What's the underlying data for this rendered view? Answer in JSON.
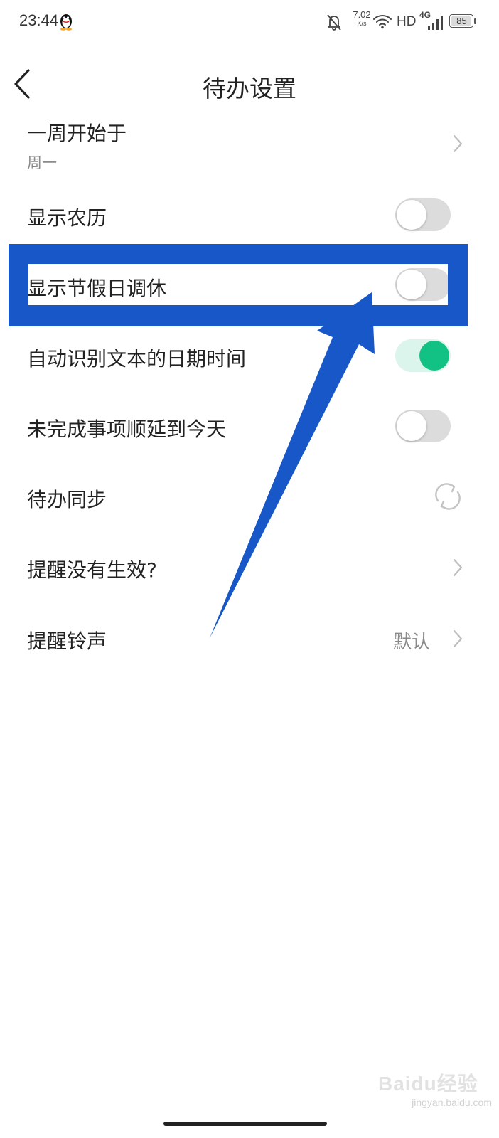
{
  "status_bar": {
    "time": "23:44",
    "speed_value": "7.02",
    "speed_unit": "K/s",
    "hd": "HD",
    "network": "4G",
    "battery": "85"
  },
  "header": {
    "title": "待办设置"
  },
  "rows": [
    {
      "label": "一周开始于",
      "sub": "周一",
      "control": "chevron"
    },
    {
      "label": "显示农历",
      "control": "toggle",
      "on": false
    },
    {
      "label": "显示节假日调休",
      "control": "toggle",
      "on": false
    },
    {
      "label": "自动识别文本的日期时间",
      "control": "toggle",
      "on": true
    },
    {
      "label": "未完成事项顺延到今天",
      "control": "toggle",
      "on": false
    },
    {
      "label": "待办同步",
      "control": "sync-icon"
    },
    {
      "label": "提醒没有生效?",
      "control": "chevron"
    },
    {
      "label": "提醒铃声",
      "value": "默认",
      "control": "chevron"
    }
  ],
  "watermark": {
    "brand": "Baidu经验",
    "url": "jingyan.baidu.com"
  },
  "colors": {
    "accent_green": "#12c184",
    "annotation_blue": "#1757c7",
    "toggle_off": "#dcdcdc"
  }
}
